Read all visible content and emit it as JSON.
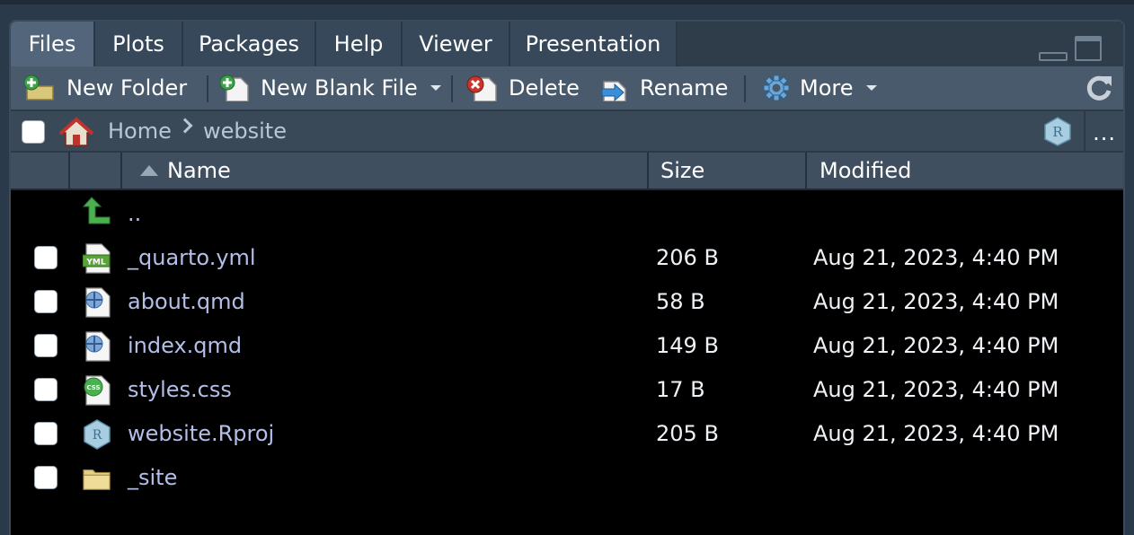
{
  "tabs": [
    {
      "label": "Files",
      "active": true
    },
    {
      "label": "Plots",
      "active": false
    },
    {
      "label": "Packages",
      "active": false
    },
    {
      "label": "Help",
      "active": false
    },
    {
      "label": "Viewer",
      "active": false
    },
    {
      "label": "Presentation",
      "active": false
    }
  ],
  "toolbar": {
    "new_folder": "New Folder",
    "new_blank_file": "New Blank File",
    "delete": "Delete",
    "rename": "Rename",
    "more": "More"
  },
  "path": {
    "home": "Home",
    "current": "website",
    "overflow": "..."
  },
  "columns": {
    "name": "Name",
    "size": "Size",
    "modified": "Modified"
  },
  "parent_dir": "..",
  "files": [
    {
      "name": "_quarto.yml",
      "size": "206 B",
      "modified": "Aug 21, 2023, 4:40 PM",
      "icon": "yml-file-icon",
      "icon_text": "YML"
    },
    {
      "name": "about.qmd",
      "size": "58 B",
      "modified": "Aug 21, 2023, 4:40 PM",
      "icon": "quarto-file-icon"
    },
    {
      "name": "index.qmd",
      "size": "149 B",
      "modified": "Aug 21, 2023, 4:40 PM",
      "icon": "quarto-file-icon"
    },
    {
      "name": "styles.css",
      "size": "17 B",
      "modified": "Aug 21, 2023, 4:40 PM",
      "icon": "css-file-icon",
      "icon_text": "CSS"
    },
    {
      "name": "website.Rproj",
      "size": "205 B",
      "modified": "Aug 21, 2023, 4:40 PM",
      "icon": "rproj-file-icon",
      "icon_text": "R"
    },
    {
      "name": "_site",
      "size": "",
      "modified": "",
      "icon": "folder-icon"
    }
  ],
  "colors": {
    "pane_bg": "#000000",
    "toolbar_bg": "#485a6c",
    "filename": "#b3bfe9",
    "active_tab": "#52657a"
  }
}
